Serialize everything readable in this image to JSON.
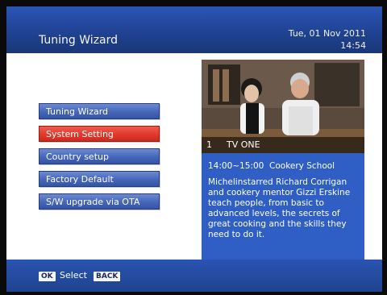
{
  "header": {
    "title": "Tuning Wizard",
    "date": "Tue, 01 Nov 2011",
    "time": "14:54"
  },
  "menu": {
    "items": [
      {
        "label": "Tuning Wizard"
      },
      {
        "label": "System Setting"
      },
      {
        "label": "Country setup"
      },
      {
        "label": "Factory Default"
      },
      {
        "label": "S/W upgrade via OTA"
      }
    ],
    "selected": "System Setting"
  },
  "preview": {
    "channel_number": "1",
    "channel_name": "TV ONE"
  },
  "program": {
    "time_range": "14:00~15:00",
    "title": "Cookery School",
    "description": "Michelinstarred Richard Corrigan and cookery mentor Gizzi Erskine teach people, from basic to advanced levels, the secrets of great cooking and the skills they need to do it."
  },
  "footer": {
    "ok_key": "OK",
    "select_label": "Select",
    "back_key": "BACK"
  },
  "colors": {
    "header_blue": "#2b56b6",
    "menu_blue": "#4868bb",
    "selected_red": "#e23a2c",
    "info_blue": "#2f5fc4"
  }
}
